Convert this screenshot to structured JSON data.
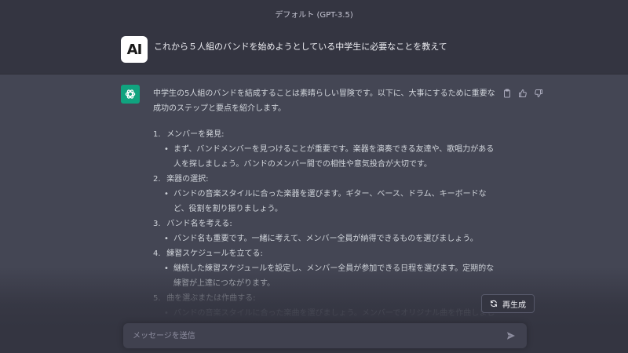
{
  "header": {
    "model_title": "デフォルト (GPT-3.5)"
  },
  "user_message": {
    "avatar_text": "AI",
    "text": "これから５人組のバンドを始めようとしている中学生に必要なことを教えて"
  },
  "assistant_message": {
    "intro": "中学生の5人組のバンドを結成することは素晴らしい冒険です。以下に、大事にするために重要な成功のステップと要点を紹介します。",
    "steps": [
      {
        "num": "1.",
        "title": "メンバーを発見:",
        "detail": "まず、バンドメンバーを見つけることが重要です。楽器を演奏できる友達や、歌唱力がある人を探しましょう。バンドのメンバー間での相性や意気投合が大切です。"
      },
      {
        "num": "2.",
        "title": "楽器の選択:",
        "detail": "バンドの音楽スタイルに合った楽器を選びます。ギター、ベース、ドラム、キーボードなど、役割を割り振りましょう。"
      },
      {
        "num": "3.",
        "title": "バンド名を考える:",
        "detail": "バンド名も重要です。一緒に考えて、メンバー全員が納得できるものを選びましょう。"
      },
      {
        "num": "4.",
        "title": "練習スケジュールを立てる:",
        "detail": "継続した練習スケジュールを設定し、メンバー全員が参加できる日程を選びます。定期的な練習が上達につながります。"
      },
      {
        "num": "5.",
        "title": "曲を選ぶまたは作曲する:",
        "detail": "バンドの音楽スタイルに合った楽曲を選びましょう。メンバーでオリジナル曲を作曲しましょう。創造力"
      }
    ]
  },
  "actions": {
    "copy_icon": "clipboard-icon",
    "like_icon": "thumbs-up-icon",
    "dislike_icon": "thumbs-down-icon"
  },
  "regenerate": {
    "label": "再生成",
    "icon": "refresh-icon"
  },
  "composer": {
    "placeholder": "メッセージを送信",
    "send_icon": "send-icon"
  },
  "colors": {
    "background": "#444654",
    "header_bg": "#343541",
    "gpt_avatar": "#10a37f",
    "input_bg": "#40414f",
    "text": "#d1d5db"
  }
}
